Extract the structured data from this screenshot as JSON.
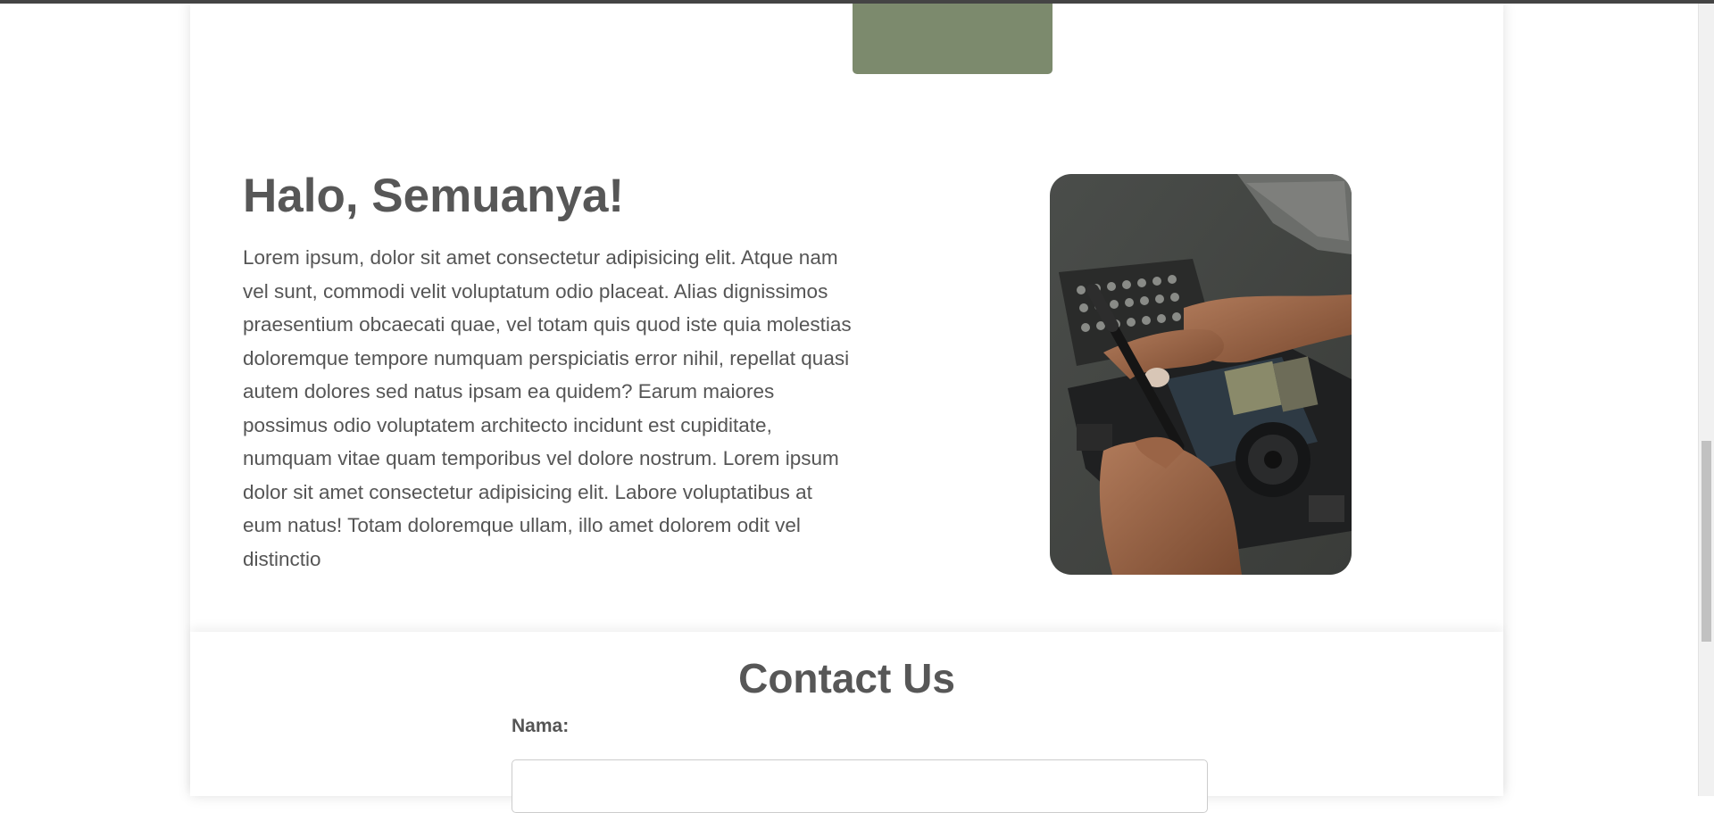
{
  "colors": {
    "accent_block": "#7c8a6d",
    "heading": "#575757",
    "body_text": "#555555"
  },
  "about": {
    "title": "Halo, Semuanya!",
    "paragraph": "Lorem ipsum, dolor sit amet consectetur adipisicing elit. Atque nam vel sunt, commodi velit voluptatum odio placeat. Alias dignissimos praesentium obcaecati quae, vel totam quis quod iste quia molestias doloremque tempore numquam perspiciatis error nihil, repellat quasi autem dolores sed natus ipsam ea quidem? Earum maiores possimus odio voluptatem architecto incidunt est cupiditate, numquam vitae quam temporibus vel dolore nostrum. Lorem ipsum dolor sit amet consectetur adipisicing elit. Labore voluptatibus at eum natus! Totam doloremque ullam, illo amet dolorem odit vel distinctio",
    "image_subject": "hands repairing laptop with screwdriver"
  },
  "contact": {
    "title": "Contact Us",
    "name_label": "Nama:",
    "name_value": "",
    "name_placeholder": ""
  }
}
